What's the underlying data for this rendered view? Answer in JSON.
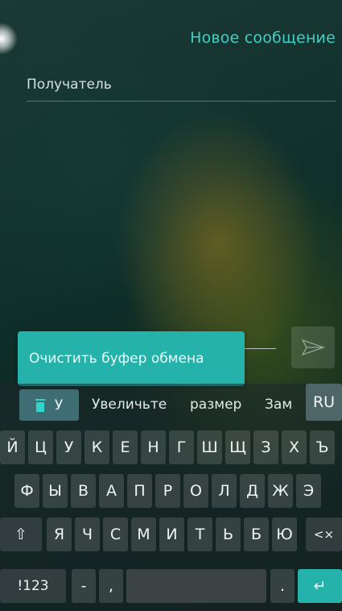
{
  "header": {
    "title": "Новое сообщение"
  },
  "recipient": {
    "placeholder": "Получатель"
  },
  "message": {
    "placeholder": ""
  },
  "toast": {
    "text": "Очистить буфер обмена"
  },
  "keyboard": {
    "clipboard_label": "У",
    "suggestions": [
      "Увеличьте",
      "размер",
      "Зам"
    ],
    "language": "RU",
    "row1": [
      "Й",
      "Ц",
      "У",
      "К",
      "Е",
      "Н",
      "Г",
      "Ш",
      "Щ",
      "З",
      "Х",
      "Ъ"
    ],
    "row2": [
      "Ф",
      "Ы",
      "В",
      "А",
      "П",
      "Р",
      "О",
      "Л",
      "Д",
      "Ж",
      "Э"
    ],
    "row3": [
      "Я",
      "Ч",
      "С",
      "М",
      "И",
      "Т",
      "Ь",
      "Б",
      "Ю"
    ],
    "shift_symbol": "⇧",
    "backspace_symbol": "<×",
    "symbols_label": "!123",
    "dash": "-",
    "comma": ",",
    "period": ".",
    "enter_symbol": "↵"
  },
  "colors": {
    "accent": "#25b2ab",
    "title": "#3fd0c6"
  }
}
